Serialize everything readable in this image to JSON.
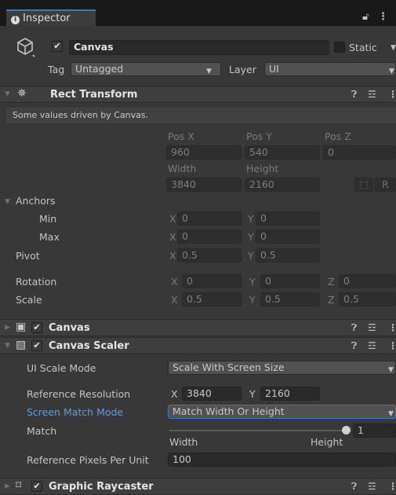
{
  "tab": {
    "title": "Inspector"
  },
  "gameobject": {
    "name": "Canvas",
    "static_label": "Static",
    "tag_label": "Tag",
    "tag_value": "Untagged",
    "layer_label": "Layer",
    "layer_value": "UI"
  },
  "rect_transform": {
    "title": "Rect Transform",
    "driven_note": "Some values driven by Canvas.",
    "posx_label": "Pos X",
    "posy_label": "Pos Y",
    "posz_label": "Pos Z",
    "posx": "960",
    "posy": "540",
    "posz": "0",
    "width_label": "Width",
    "height_label": "Height",
    "width": "3840",
    "height": "2160",
    "r_button": "R",
    "anchors_label": "Anchors",
    "min_label": "Min",
    "max_label": "Max",
    "min_x": "0",
    "min_y": "0",
    "max_x": "0",
    "max_y": "0",
    "pivot_label": "Pivot",
    "pivot_x": "0.5",
    "pivot_y": "0.5",
    "rotation_label": "Rotation",
    "rot_x": "0",
    "rot_y": "0",
    "rot_z": "0",
    "scale_label": "Scale",
    "scale_x": "0.5",
    "scale_y": "0.5",
    "scale_z": "0.5",
    "x": "X",
    "y": "Y",
    "z": "Z"
  },
  "canvas": {
    "title": "Canvas"
  },
  "canvas_scaler": {
    "title": "Canvas Scaler",
    "ui_scale_mode_label": "UI Scale Mode",
    "ui_scale_mode_value": "Scale With Screen Size",
    "ref_res_label": "Reference Resolution",
    "ref_res_x": "3840",
    "ref_res_y": "2160",
    "screen_match_label": "Screen Match Mode",
    "screen_match_value": "Match Width Or Height",
    "match_label": "Match",
    "match_value": "1",
    "match_fraction": 1,
    "width_label": "Width",
    "height_label": "Height",
    "ref_ppu_label": "Reference Pixels Per Unit",
    "ref_ppu_value": "100"
  },
  "graphic_raycaster": {
    "title": "Graphic Raycaster"
  },
  "colors": {
    "accent": "#3a79bb",
    "selected_label": "#5c9ce6"
  }
}
